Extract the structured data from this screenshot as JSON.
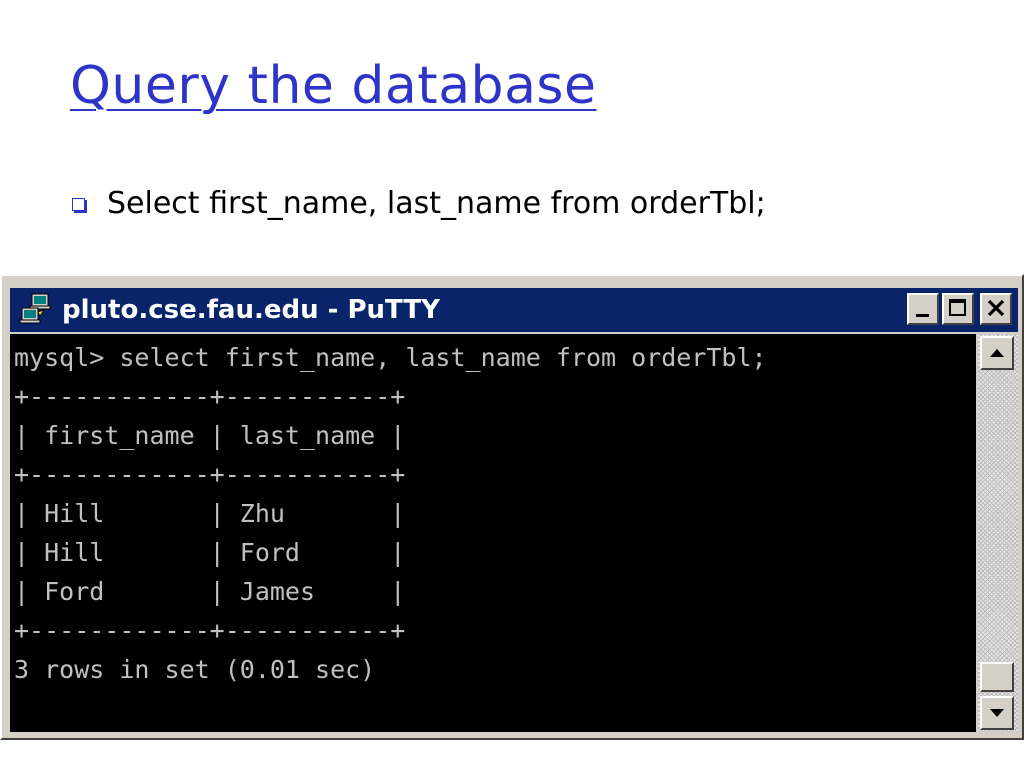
{
  "slide": {
    "title": "Query the database",
    "bullet": "Select first_name, last_name from orderTbl;"
  },
  "window": {
    "title": "pluto.cse.fau.edu - PuTTY",
    "icons": {
      "app": "putty-computers-icon",
      "minimize": "minimize-icon",
      "maximize": "maximize-icon",
      "close": "close-icon",
      "scroll_up": "arrow-up-icon",
      "scroll_down": "arrow-down-icon"
    }
  },
  "terminal": {
    "lines": [
      "mysql> select first_name, last_name from orderTbl;",
      "+------------+-----------+",
      "| first_name | last_name |",
      "+------------+-----------+",
      "| Hill       | Zhu       |",
      "| Hill       | Ford      |",
      "| Ford       | James     |",
      "+------------+-----------+",
      "3 rows in set (0.01 sec)"
    ]
  },
  "colors": {
    "title_blue": "#2e34c8",
    "titlebar_blue": "#0a246a",
    "terminal_bg": "#000000",
    "terminal_text": "#c0c0c0",
    "window_face": "#d4d0c8"
  }
}
